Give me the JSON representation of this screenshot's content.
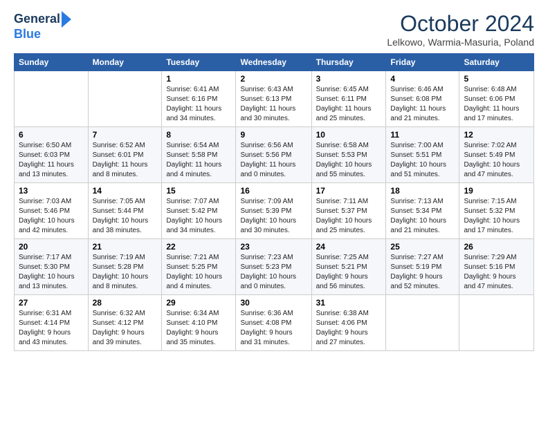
{
  "header": {
    "logo_line1": "General",
    "logo_line2": "Blue",
    "month": "October 2024",
    "location": "Lelkowo, Warmia-Masuria, Poland"
  },
  "days_of_week": [
    "Sunday",
    "Monday",
    "Tuesday",
    "Wednesday",
    "Thursday",
    "Friday",
    "Saturday"
  ],
  "weeks": [
    [
      {
        "day": "",
        "info": ""
      },
      {
        "day": "",
        "info": ""
      },
      {
        "day": "1",
        "info": "Sunrise: 6:41 AM\nSunset: 6:16 PM\nDaylight: 11 hours\nand 34 minutes."
      },
      {
        "day": "2",
        "info": "Sunrise: 6:43 AM\nSunset: 6:13 PM\nDaylight: 11 hours\nand 30 minutes."
      },
      {
        "day": "3",
        "info": "Sunrise: 6:45 AM\nSunset: 6:11 PM\nDaylight: 11 hours\nand 25 minutes."
      },
      {
        "day": "4",
        "info": "Sunrise: 6:46 AM\nSunset: 6:08 PM\nDaylight: 11 hours\nand 21 minutes."
      },
      {
        "day": "5",
        "info": "Sunrise: 6:48 AM\nSunset: 6:06 PM\nDaylight: 11 hours\nand 17 minutes."
      }
    ],
    [
      {
        "day": "6",
        "info": "Sunrise: 6:50 AM\nSunset: 6:03 PM\nDaylight: 11 hours\nand 13 minutes."
      },
      {
        "day": "7",
        "info": "Sunrise: 6:52 AM\nSunset: 6:01 PM\nDaylight: 11 hours\nand 8 minutes."
      },
      {
        "day": "8",
        "info": "Sunrise: 6:54 AM\nSunset: 5:58 PM\nDaylight: 11 hours\nand 4 minutes."
      },
      {
        "day": "9",
        "info": "Sunrise: 6:56 AM\nSunset: 5:56 PM\nDaylight: 11 hours\nand 0 minutes."
      },
      {
        "day": "10",
        "info": "Sunrise: 6:58 AM\nSunset: 5:53 PM\nDaylight: 10 hours\nand 55 minutes."
      },
      {
        "day": "11",
        "info": "Sunrise: 7:00 AM\nSunset: 5:51 PM\nDaylight: 10 hours\nand 51 minutes."
      },
      {
        "day": "12",
        "info": "Sunrise: 7:02 AM\nSunset: 5:49 PM\nDaylight: 10 hours\nand 47 minutes."
      }
    ],
    [
      {
        "day": "13",
        "info": "Sunrise: 7:03 AM\nSunset: 5:46 PM\nDaylight: 10 hours\nand 42 minutes."
      },
      {
        "day": "14",
        "info": "Sunrise: 7:05 AM\nSunset: 5:44 PM\nDaylight: 10 hours\nand 38 minutes."
      },
      {
        "day": "15",
        "info": "Sunrise: 7:07 AM\nSunset: 5:42 PM\nDaylight: 10 hours\nand 34 minutes."
      },
      {
        "day": "16",
        "info": "Sunrise: 7:09 AM\nSunset: 5:39 PM\nDaylight: 10 hours\nand 30 minutes."
      },
      {
        "day": "17",
        "info": "Sunrise: 7:11 AM\nSunset: 5:37 PM\nDaylight: 10 hours\nand 25 minutes."
      },
      {
        "day": "18",
        "info": "Sunrise: 7:13 AM\nSunset: 5:34 PM\nDaylight: 10 hours\nand 21 minutes."
      },
      {
        "day": "19",
        "info": "Sunrise: 7:15 AM\nSunset: 5:32 PM\nDaylight: 10 hours\nand 17 minutes."
      }
    ],
    [
      {
        "day": "20",
        "info": "Sunrise: 7:17 AM\nSunset: 5:30 PM\nDaylight: 10 hours\nand 13 minutes."
      },
      {
        "day": "21",
        "info": "Sunrise: 7:19 AM\nSunset: 5:28 PM\nDaylight: 10 hours\nand 8 minutes."
      },
      {
        "day": "22",
        "info": "Sunrise: 7:21 AM\nSunset: 5:25 PM\nDaylight: 10 hours\nand 4 minutes."
      },
      {
        "day": "23",
        "info": "Sunrise: 7:23 AM\nSunset: 5:23 PM\nDaylight: 10 hours\nand 0 minutes."
      },
      {
        "day": "24",
        "info": "Sunrise: 7:25 AM\nSunset: 5:21 PM\nDaylight: 9 hours\nand 56 minutes."
      },
      {
        "day": "25",
        "info": "Sunrise: 7:27 AM\nSunset: 5:19 PM\nDaylight: 9 hours\nand 52 minutes."
      },
      {
        "day": "26",
        "info": "Sunrise: 7:29 AM\nSunset: 5:16 PM\nDaylight: 9 hours\nand 47 minutes."
      }
    ],
    [
      {
        "day": "27",
        "info": "Sunrise: 6:31 AM\nSunset: 4:14 PM\nDaylight: 9 hours\nand 43 minutes."
      },
      {
        "day": "28",
        "info": "Sunrise: 6:32 AM\nSunset: 4:12 PM\nDaylight: 9 hours\nand 39 minutes."
      },
      {
        "day": "29",
        "info": "Sunrise: 6:34 AM\nSunset: 4:10 PM\nDaylight: 9 hours\nand 35 minutes."
      },
      {
        "day": "30",
        "info": "Sunrise: 6:36 AM\nSunset: 4:08 PM\nDaylight: 9 hours\nand 31 minutes."
      },
      {
        "day": "31",
        "info": "Sunrise: 6:38 AM\nSunset: 4:06 PM\nDaylight: 9 hours\nand 27 minutes."
      },
      {
        "day": "",
        "info": ""
      },
      {
        "day": "",
        "info": ""
      }
    ]
  ]
}
